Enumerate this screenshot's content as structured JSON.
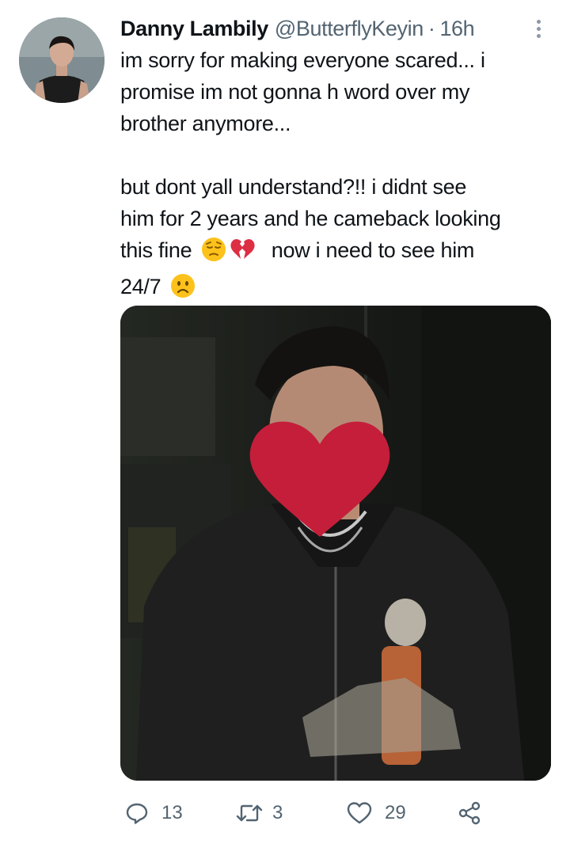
{
  "tweet": {
    "display_name": "Danny Lambily",
    "handle": "@ButterflyKeyin",
    "separator": "·",
    "time": "16h",
    "lines_para1": [
      "im sorry for making everyone scared... i",
      "promise im not gonna h word over my",
      "brother anymore..."
    ],
    "lines_para2": [
      "but dont yall understand?!! i didnt see",
      "him for 2 years and he cameback looking"
    ],
    "line_fine_prefix": "this fine",
    "line_fine_suffix": "now i need to see him",
    "line_last": "24/7",
    "emojis": [
      "pensive-face",
      "broken-heart",
      "frowning-face"
    ]
  },
  "actions": {
    "replies": "13",
    "retweets": "3",
    "likes": "29"
  },
  "colors": {
    "text": "#0f1419",
    "secondary": "#536471",
    "heart_censor": "#c41e3a"
  }
}
